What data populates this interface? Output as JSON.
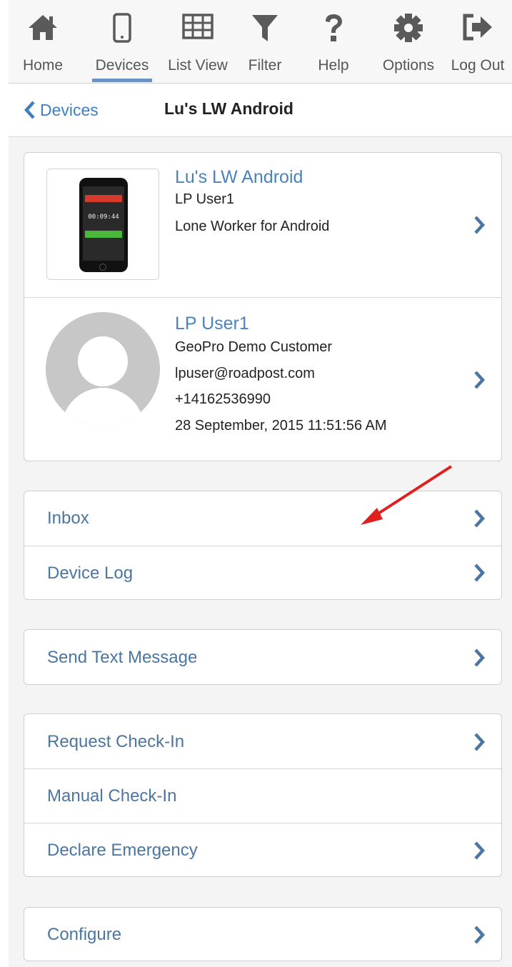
{
  "nav": {
    "items": [
      {
        "label": "Home",
        "icon": "home-icon"
      },
      {
        "label": "Devices",
        "icon": "phone-icon",
        "active": true
      },
      {
        "label": "List View",
        "icon": "grid-icon"
      },
      {
        "label": "Filter",
        "icon": "filter-icon"
      },
      {
        "label": "Help",
        "icon": "question-icon"
      },
      {
        "label": "Options",
        "icon": "gear-icon"
      },
      {
        "label": "Log Out",
        "icon": "logout-icon"
      }
    ]
  },
  "header": {
    "back_label": "Devices",
    "title": "Lu's LW Android"
  },
  "device": {
    "name": "Lu's LW Android",
    "user": "LP User1",
    "app": "Lone Worker for Android",
    "screen_clock": "00:09:44"
  },
  "user": {
    "name": "LP User1",
    "customer": "GeoPro Demo Customer",
    "email": "lpuser@roadpost.com",
    "phone": "+14162536990",
    "timestamp": "28 September, 2015 11:51:56 AM"
  },
  "menu": {
    "inbox": "Inbox",
    "device_log": "Device Log",
    "send_text": "Send Text Message",
    "request_checkin": "Request Check-In",
    "manual_checkin": "Manual Check-In",
    "declare_emergency": "Declare Emergency",
    "configure": "Configure"
  },
  "colors": {
    "accent": "#4b76a1",
    "link": "#4b82bd",
    "annotation_arrow": "#e02020",
    "nav_underline": "#6b93c2"
  }
}
